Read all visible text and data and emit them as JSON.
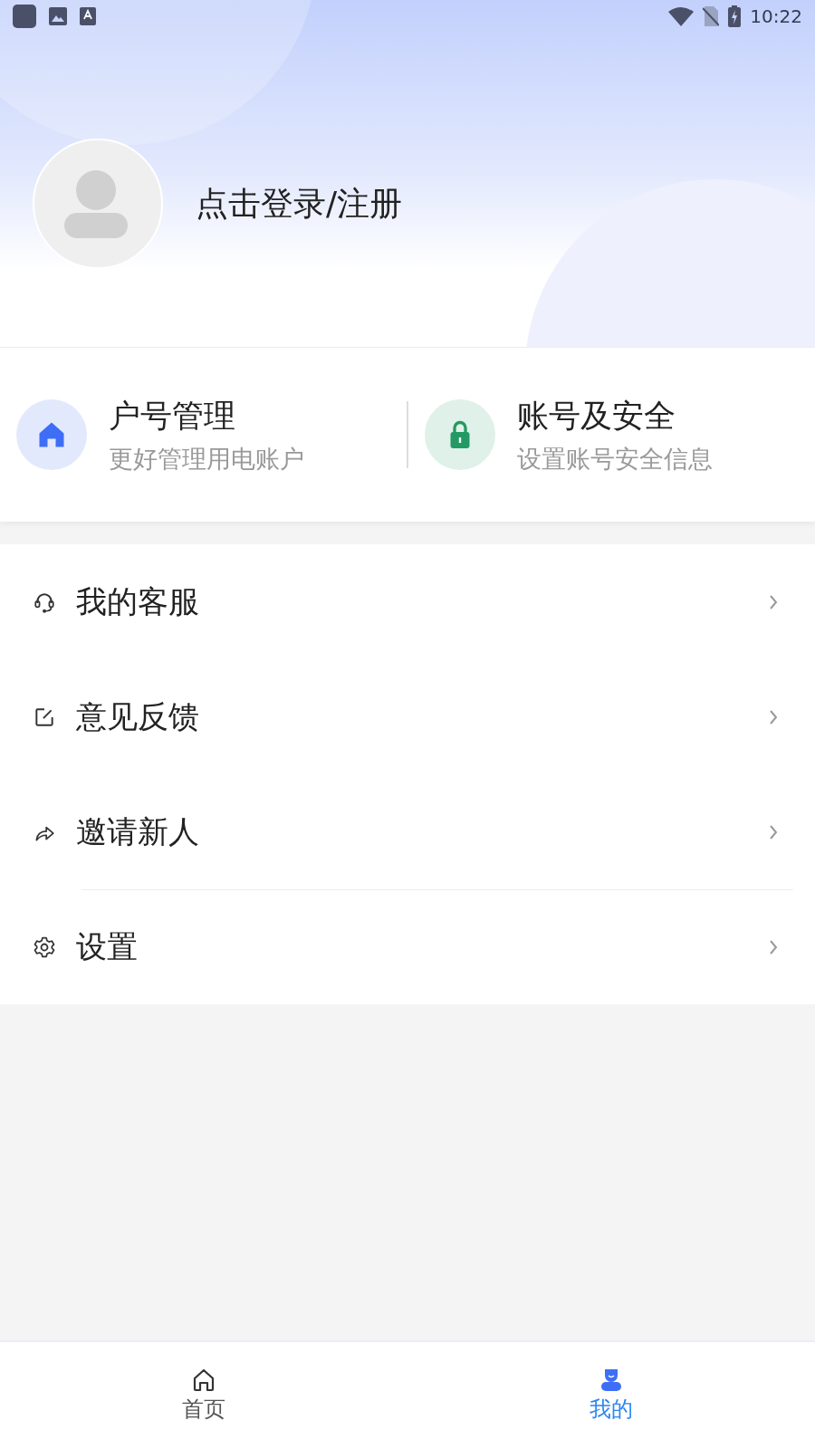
{
  "status_bar": {
    "time": "10:22"
  },
  "profile": {
    "login_label": "点击登录/注册"
  },
  "shortcuts": [
    {
      "kind": "house",
      "title": "户号管理",
      "subtitle": "更好管理用电账户"
    },
    {
      "kind": "lock",
      "title": "账号及安全",
      "subtitle": "设置账号安全信息"
    }
  ],
  "menu": [
    {
      "kind": "headset",
      "label": "我的客服",
      "separated": false
    },
    {
      "kind": "edit",
      "label": "意见反馈",
      "separated": false
    },
    {
      "kind": "share",
      "label": "邀请新人",
      "separated": false
    },
    {
      "kind": "gear",
      "label": "设置",
      "separated": true
    }
  ],
  "bottom_nav": [
    {
      "kind": "home",
      "label": "首页",
      "selected": false
    },
    {
      "kind": "user",
      "label": "我的",
      "selected": true
    }
  ]
}
